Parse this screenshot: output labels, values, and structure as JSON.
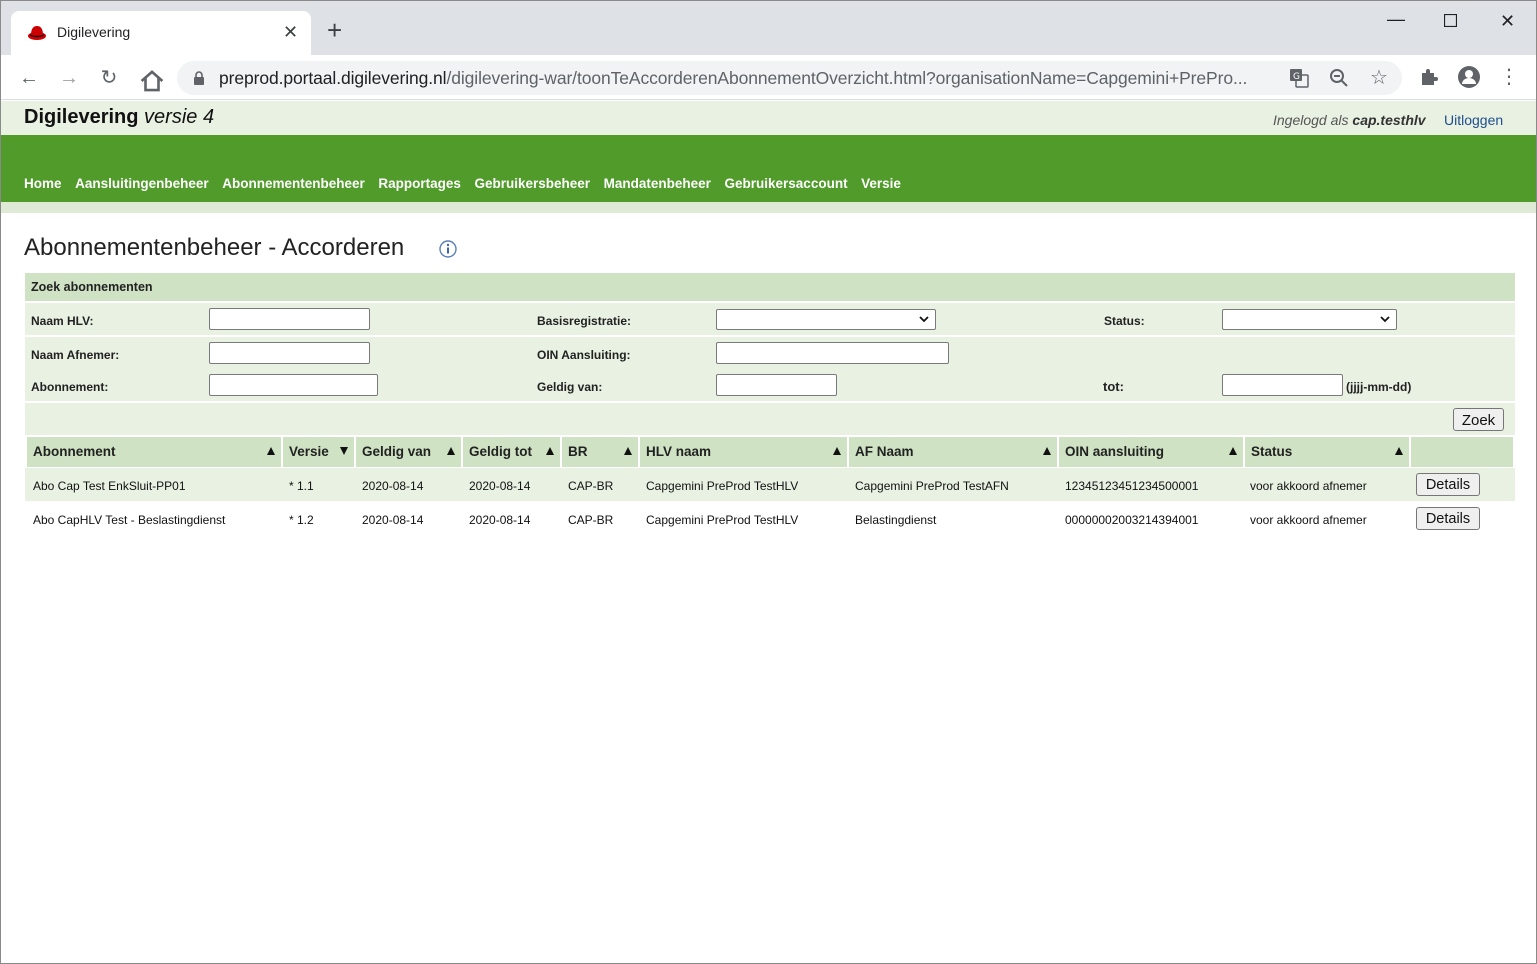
{
  "browser": {
    "tab_title": "Digilevering",
    "url_host": "preprod.portaal.digilevering.nl",
    "url_path": "/digilevering-war/toonTeAccorderenAbonnementOverzicht.html?organisationName=Capgemini+PrePro..."
  },
  "header": {
    "brand": "Digilevering",
    "version": "versie 4",
    "logged_in_prefix": "Ingelogd als",
    "username": "cap.testhlv",
    "logout_label": "Uitloggen"
  },
  "nav": {
    "items": [
      "Home",
      "Aansluitingenbeheer",
      "Abonnementenbeheer",
      "Rapportages",
      "Gebruikersbeheer",
      "Mandatenbeheer",
      "Gebruikersaccount",
      "Versie"
    ]
  },
  "page": {
    "title": "Abonnementenbeheer - Accorderen"
  },
  "search": {
    "heading": "Zoek abonnementen",
    "naam_hlv_label": "Naam HLV:",
    "basisregistratie_label": "Basisregistratie:",
    "status_label": "Status:",
    "naam_afnemer_label": "Naam Afnemer:",
    "oin_aansluiting_label": "OIN Aansluiting:",
    "abonnement_label": "Abonnement:",
    "geldig_van_label": "Geldig van:",
    "tot_label": "tot:",
    "date_hint": "(jjjj-mm-dd)",
    "submit_label": "Zoek"
  },
  "table": {
    "headers": [
      "Abonnement",
      "Versie",
      "Geldig van",
      "Geldig tot",
      "BR",
      "HLV naam",
      "AF Naam",
      "OIN aansluiting",
      "Status"
    ],
    "rows": [
      {
        "abonnement": "Abo Cap Test EnkSluit-PP01",
        "versie": "* 1.1",
        "geldig_van": "2020-08-14",
        "geldig_tot": "2020-08-14",
        "br": "CAP-BR",
        "hlv_naam": "Capgemini PreProd TestHLV",
        "af_naam": "Capgemini PreProd TestAFN",
        "oin": "12345123451234500001",
        "status": "voor akkoord afnemer",
        "action": "Details"
      },
      {
        "abonnement": "Abo CapHLV Test - Beslastingdienst",
        "versie": "* 1.2",
        "geldig_van": "2020-08-14",
        "geldig_tot": "2020-08-14",
        "br": "CAP-BR",
        "hlv_naam": "Capgemini PreProd TestHLV",
        "af_naam": "Belastingdienst",
        "oin": "00000002003214394001",
        "status": "voor akkoord afnemer",
        "action": "Details"
      }
    ]
  }
}
